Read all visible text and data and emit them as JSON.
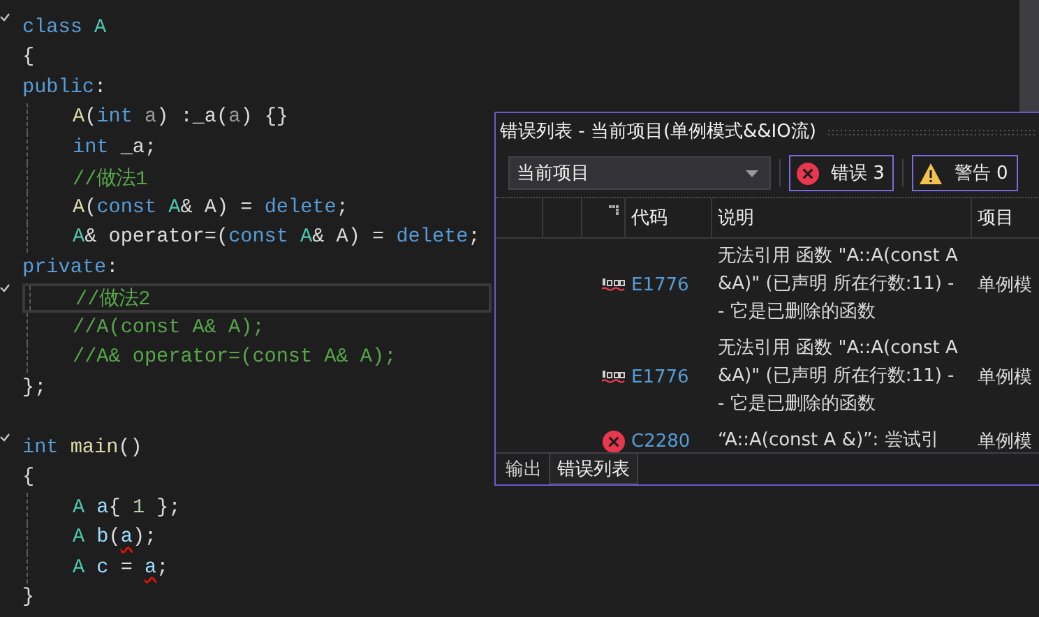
{
  "editor": {
    "blocks": [
      {
        "lines": [
          {
            "fold": true,
            "tokens": [
              {
                "kind": "keyword",
                "text": "class"
              },
              {
                "kind": "type",
                "text": " A"
              }
            ]
          },
          {
            "tokens": [
              {
                "kind": "plain",
                "text": "{"
              }
            ]
          },
          {
            "tokens": [
              {
                "kind": "keyword",
                "text": "public"
              },
              {
                "kind": "plain",
                "text": ":"
              }
            ]
          },
          {
            "guide": true,
            "tokens": [
              {
                "kind": "func",
                "text": "A"
              },
              {
                "kind": "plain",
                "text": "("
              },
              {
                "kind": "keyword",
                "text": "int"
              },
              {
                "kind": "param",
                "text": " a"
              },
              {
                "kind": "plain",
                "text": ") :_a("
              },
              {
                "kind": "param",
                "text": "a"
              },
              {
                "kind": "plain",
                "text": ") {}"
              }
            ]
          },
          {
            "guide": true,
            "tokens": [
              {
                "kind": "keyword",
                "text": "int"
              },
              {
                "kind": "plain",
                "text": " _a;"
              }
            ]
          },
          {
            "guide": true,
            "tokens": [
              {
                "kind": "comment",
                "text": "//做法1"
              }
            ]
          },
          {
            "guide": true,
            "tokens": [
              {
                "kind": "func",
                "text": "A"
              },
              {
                "kind": "plain",
                "text": "("
              },
              {
                "kind": "keyword",
                "text": "const"
              },
              {
                "kind": "type",
                "text": " A"
              },
              {
                "kind": "plain",
                "text": "& A) = "
              },
              {
                "kind": "keyword",
                "text": "delete"
              },
              {
                "kind": "plain",
                "text": ";"
              }
            ]
          },
          {
            "guide": true,
            "tokens": [
              {
                "kind": "type",
                "text": "A"
              },
              {
                "kind": "plain",
                "text": "& operator=("
              },
              {
                "kind": "keyword",
                "text": "const"
              },
              {
                "kind": "type",
                "text": " A"
              },
              {
                "kind": "plain",
                "text": "& A) = "
              },
              {
                "kind": "keyword",
                "text": "delete"
              },
              {
                "kind": "plain",
                "text": ";"
              }
            ]
          },
          {
            "tokens": [
              {
                "kind": "keyword",
                "text": "private"
              },
              {
                "kind": "plain",
                "text": ":"
              }
            ]
          },
          {
            "fold": true,
            "current": true,
            "guide": true,
            "tokens": [
              {
                "kind": "comment",
                "text": "//做法2"
              }
            ]
          },
          {
            "guide": true,
            "tokens": [
              {
                "kind": "comment",
                "text": "//A(const A& A);"
              }
            ]
          },
          {
            "guide": true,
            "tokens": [
              {
                "kind": "comment",
                "text": "//A& operator=(const A& A);"
              }
            ]
          },
          {
            "tokens": [
              {
                "kind": "plain",
                "text": "};"
              }
            ]
          }
        ]
      },
      {
        "lines": [
          {
            "fold": true,
            "tokens": [
              {
                "kind": "keyword",
                "text": "int"
              },
              {
                "kind": "func",
                "text": " main"
              },
              {
                "kind": "plain",
                "text": "()"
              }
            ]
          },
          {
            "tokens": [
              {
                "kind": "plain",
                "text": "{"
              }
            ]
          },
          {
            "guide": true,
            "tokens": [
              {
                "kind": "type",
                "text": "A"
              },
              {
                "kind": "var",
                "text": " a"
              },
              {
                "kind": "plain",
                "text": "{ "
              },
              {
                "kind": "number",
                "text": "1"
              },
              {
                "kind": "plain",
                "text": " };"
              }
            ]
          },
          {
            "guide": true,
            "tokens": [
              {
                "kind": "type",
                "text": "A"
              },
              {
                "kind": "var",
                "text": " b"
              },
              {
                "kind": "plain",
                "text": "("
              },
              {
                "kind": "error",
                "text": "a"
              },
              {
                "kind": "plain",
                "text": ");"
              }
            ]
          },
          {
            "guide": true,
            "tokens": [
              {
                "kind": "type",
                "text": "A"
              },
              {
                "kind": "var",
                "text": " c"
              },
              {
                "kind": "plain",
                "text": " = "
              },
              {
                "kind": "error",
                "text": "a"
              },
              {
                "kind": "plain",
                "text": ";"
              }
            ]
          },
          {
            "tokens": [
              {
                "kind": "plain",
                "text": "}"
              }
            ]
          }
        ]
      }
    ]
  },
  "error_list": {
    "title": "错误列表 - 当前项目(单例模式&&IO流)",
    "scope_dropdown": {
      "value": "当前项目"
    },
    "filters": [
      {
        "kind": "error",
        "label": "错误 3",
        "selected": true
      },
      {
        "kind": "warning",
        "label": "警告 0",
        "selected": true
      }
    ],
    "columns": [
      "代码",
      "说明",
      "项目"
    ],
    "rows": [
      {
        "kind": "intellisense",
        "code": "E1776",
        "description": "无法引用 函数 \"A::A(const A &A)\" (已声明 所在行数:11) -- 它是已删除的函数",
        "project": "单例模"
      },
      {
        "kind": "intellisense",
        "code": "E1776",
        "description": "无法引用 函数 \"A::A(const A &A)\" (已声明 所在行数:11) -- 它是已删除的函数",
        "project": "单例模"
      },
      {
        "kind": "build",
        "code": "C2280",
        "description": "“A::A(const A &)”: 尝试引",
        "project": "单例模"
      }
    ],
    "tabs": [
      {
        "label": "输出",
        "selected": false
      },
      {
        "label": "错误列表",
        "selected": true
      }
    ]
  }
}
